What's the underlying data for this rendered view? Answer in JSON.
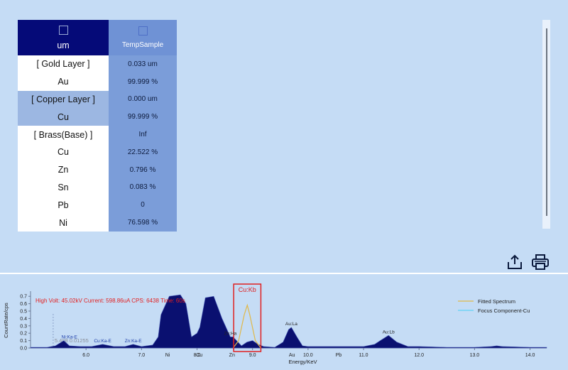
{
  "results_table": {
    "header": {
      "unit": "um",
      "sample": "TempSample"
    },
    "rows": [
      {
        "label": "[ Gold Layer ]",
        "value": "0.033 um",
        "selected": false
      },
      {
        "label": "Au",
        "value": "99.999 %",
        "selected": false
      },
      {
        "label": "[ Copper Layer ]",
        "value": "0.000 um",
        "selected": true
      },
      {
        "label": "Cu",
        "value": "99.999 %",
        "selected": true
      },
      {
        "label": "[ Brass(Base) ]",
        "value": "Inf",
        "selected": false
      },
      {
        "label": "Cu",
        "value": "22.522 %",
        "selected": false
      },
      {
        "label": "Zn",
        "value": "0.796 %",
        "selected": false
      },
      {
        "label": "Sn",
        "value": "0.083 %",
        "selected": false
      },
      {
        "label": "Pb",
        "value": "0",
        "selected": false
      },
      {
        "label": "Ni",
        "value": "76.598 %",
        "selected": false
      }
    ]
  },
  "toolbar": {
    "export_icon": "export-icon",
    "print_icon": "printer-icon"
  },
  "spectrum": {
    "info_line": "High Volt: 45.02kV  Current: 598.86uA  CPS: 6438  Time: 60s",
    "cursor_readout": "5.408  0.01255",
    "highlight_label": "Cu:Kb",
    "colors": {
      "info": "#e32020",
      "fill": "#0a1070",
      "fitted": "#e0b84a",
      "focus": "#5fd3f5",
      "highlight_box": "#e02020"
    }
  },
  "chart_data": {
    "type": "area",
    "xlabel": "Energy/KeV",
    "ylabel": "CountRate/cps",
    "xlim": [
      5.0,
      14.3
    ],
    "ylim": [
      0,
      0.75
    ],
    "x_ticks": [
      "6.0",
      "7.0",
      "8.0",
      "9.0",
      "10.0",
      "11.0",
      "12.0",
      "13.0",
      "14.0"
    ],
    "y_ticks": [
      "0.0",
      "0.1",
      "0.2",
      "0.3",
      "0.4",
      "0.5",
      "0.6",
      "0.7"
    ],
    "legend": [
      "Fitted Spectrum",
      "Focus Component-Cu"
    ],
    "legend_position": "top-right",
    "series": [
      {
        "name": "Fitted Spectrum",
        "x": [
          5.0,
          5.3,
          5.45,
          5.6,
          5.7,
          5.9,
          6.1,
          6.3,
          6.5,
          6.7,
          6.85,
          7.0,
          7.2,
          7.3,
          7.35,
          7.5,
          7.7,
          7.8,
          7.9,
          8.0,
          8.05,
          8.15,
          8.3,
          8.45,
          8.6,
          8.65,
          8.8,
          8.9,
          9.0,
          9.1,
          9.2,
          9.4,
          9.55,
          9.65,
          9.7,
          9.8,
          9.9,
          10.0,
          10.2,
          10.5,
          10.8,
          11.0,
          11.2,
          11.3,
          11.45,
          11.6,
          11.8,
          12.0,
          12.5,
          13.0,
          13.3,
          13.4,
          13.5,
          14.0,
          14.3
        ],
        "y": [
          0.01,
          0.01,
          0.03,
          0.1,
          0.03,
          0.02,
          0.02,
          0.05,
          0.02,
          0.02,
          0.05,
          0.02,
          0.04,
          0.15,
          0.45,
          0.7,
          0.72,
          0.6,
          0.15,
          0.2,
          0.28,
          0.68,
          0.7,
          0.4,
          0.15,
          0.15,
          0.03,
          0.08,
          0.1,
          0.05,
          0.02,
          0.01,
          0.08,
          0.25,
          0.28,
          0.15,
          0.03,
          0.02,
          0.02,
          0.02,
          0.02,
          0.02,
          0.05,
          0.1,
          0.17,
          0.08,
          0.02,
          0.02,
          0.01,
          0.01,
          0.02,
          0.03,
          0.02,
          0.01,
          0.01
        ]
      },
      {
        "name": "Focus Component-Cu",
        "x": [
          8.65,
          8.75,
          8.85,
          8.905,
          8.95,
          9.05,
          9.15
        ],
        "y": [
          0.0,
          0.1,
          0.45,
          0.58,
          0.45,
          0.1,
          0.0
        ]
      }
    ],
    "peak_labels": [
      {
        "label": "Ni:Ka-E",
        "x": 5.7,
        "y": 0.11
      },
      {
        "label": "Cu:Ka-E",
        "x": 6.3,
        "y": 0.06
      },
      {
        "label": "Zn:Ka-E",
        "x": 6.85,
        "y": 0.06
      },
      {
        "label": "Zn:Ha",
        "x": 8.6,
        "y": 0.16
      },
      {
        "label": "Au:La",
        "x": 9.7,
        "y": 0.29
      },
      {
        "label": "Au:Lb",
        "x": 11.45,
        "y": 0.18
      }
    ],
    "element_markers": [
      {
        "label": "Ni",
        "x": 7.47
      },
      {
        "label": "Cu",
        "x": 8.04
      },
      {
        "label": "Zn",
        "x": 8.63
      },
      {
        "label": "Au",
        "x": 9.71
      },
      {
        "label": "Pb",
        "x": 10.55
      }
    ]
  }
}
